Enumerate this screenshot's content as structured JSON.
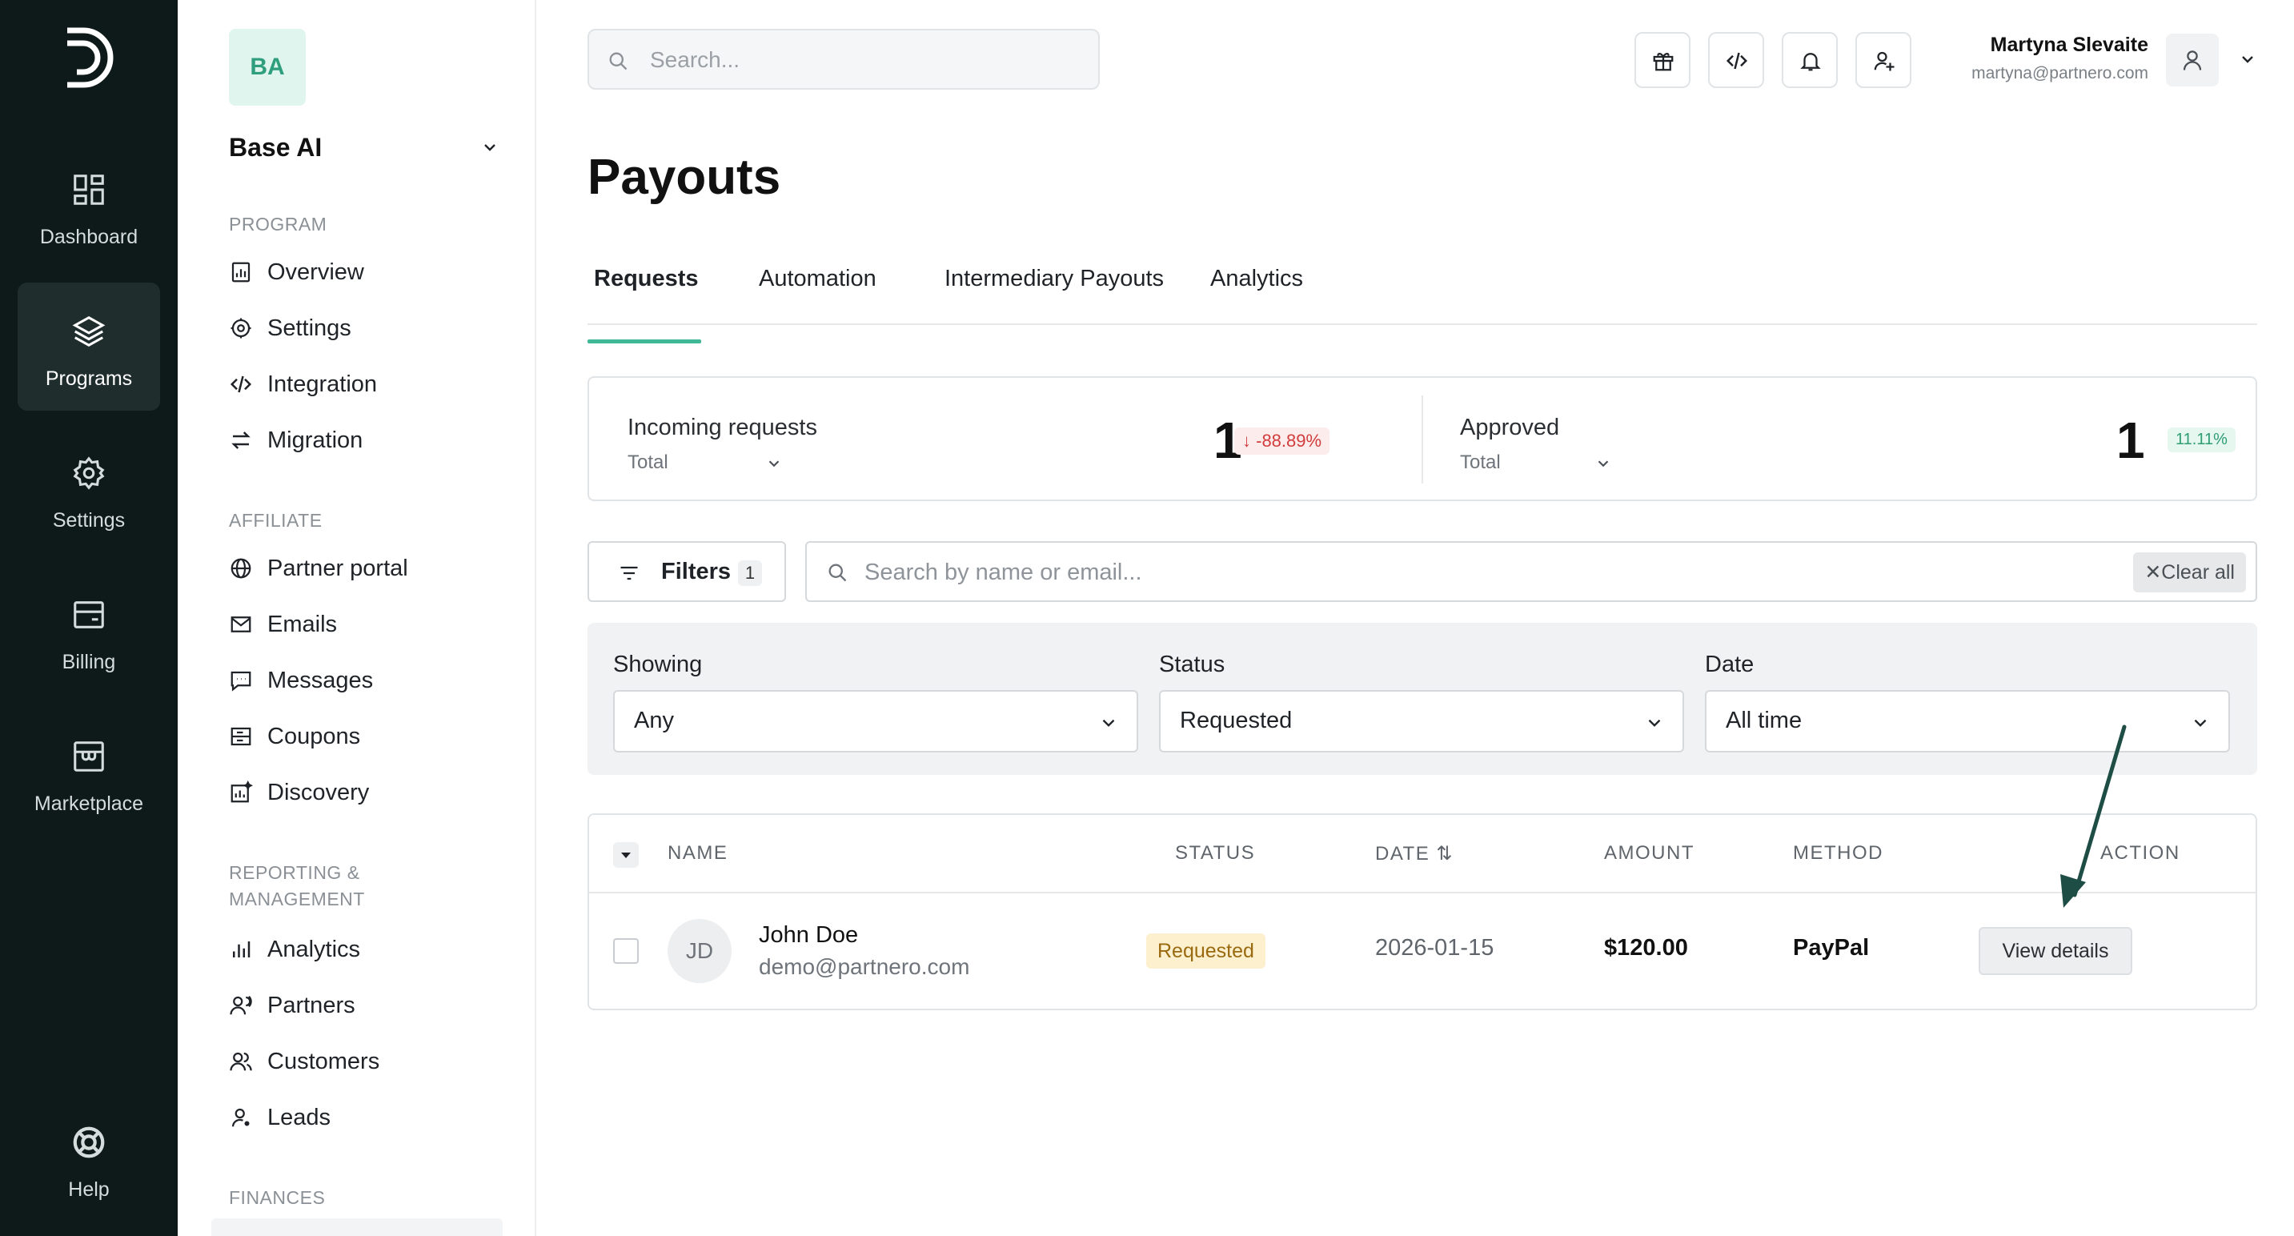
{
  "rail": {
    "items": [
      {
        "label": "Dashboard",
        "icon": "dashboard-icon"
      },
      {
        "label": "Programs",
        "icon": "layers-icon",
        "active": true
      },
      {
        "label": "Settings",
        "icon": "gear-icon"
      },
      {
        "label": "Billing",
        "icon": "wallet-icon"
      },
      {
        "label": "Marketplace",
        "icon": "store-icon"
      }
    ],
    "help": {
      "label": "Help",
      "icon": "lifebuoy-icon"
    }
  },
  "program": {
    "initials": "BA",
    "name": "Base AI"
  },
  "sidebar": {
    "sections": {
      "program": "PROGRAM",
      "affiliate": "AFFILIATE",
      "reporting_line1": "REPORTING &",
      "reporting_line2": "MANAGEMENT",
      "finances": "FINANCES"
    },
    "program_items": [
      {
        "label": "Overview",
        "icon": "chart-file-icon"
      },
      {
        "label": "Settings",
        "icon": "gear-icon"
      },
      {
        "label": "Integration",
        "icon": "code-icon"
      },
      {
        "label": "Migration",
        "icon": "swap-arrows-icon"
      }
    ],
    "affiliate_items": [
      {
        "label": "Partner portal",
        "icon": "globe-icon"
      },
      {
        "label": "Emails",
        "icon": "mail-icon"
      },
      {
        "label": "Messages",
        "icon": "message-icon"
      },
      {
        "label": "Coupons",
        "icon": "coupon-icon"
      },
      {
        "label": "Discovery",
        "icon": "discovery-icon"
      }
    ],
    "reporting_items": [
      {
        "label": "Analytics",
        "icon": "bar-chart-icon"
      },
      {
        "label": "Partners",
        "icon": "partners-icon"
      },
      {
        "label": "Customers",
        "icon": "customers-icon"
      },
      {
        "label": "Leads",
        "icon": "lead-icon"
      }
    ]
  },
  "header": {
    "search_placeholder": "Search...",
    "user_name": "Martyna Slevaite",
    "user_email": "martyna@partnero.com"
  },
  "page": {
    "title": "Payouts",
    "tabs": [
      "Requests",
      "Automation",
      "Intermediary Payouts",
      "Analytics"
    ],
    "active_tab": "Requests"
  },
  "stats": {
    "incoming": {
      "title": "Incoming requests",
      "period": "Total",
      "value": "1",
      "change": "↓ -88.89%"
    },
    "approved": {
      "title": "Approved",
      "period": "Total",
      "value": "1",
      "change": "11.11%"
    }
  },
  "filters": {
    "button_label": "Filters",
    "count": "1",
    "search_placeholder": "Search by name or email...",
    "clear_all": "✕Clear all",
    "showing": {
      "label": "Showing",
      "value": "Any"
    },
    "status": {
      "label": "Status",
      "value": "Requested"
    },
    "date": {
      "label": "Date",
      "value": "All time"
    }
  },
  "table": {
    "columns": [
      "NAME",
      "STATUS",
      "DATE ⇅",
      "AMOUNT",
      "METHOD",
      "ACTION"
    ],
    "rows": [
      {
        "initials": "JD",
        "name": "John Doe",
        "email": "demo@partnero.com",
        "status": "Requested",
        "date": "2026-01-15",
        "amount": "$120.00",
        "method": "PayPal",
        "action": "View details"
      }
    ]
  },
  "colors": {
    "rail_bg": "#0e1a1a",
    "accent": "#3fb896",
    "status_requested_bg": "#fcf0cf",
    "arrow": "#1d4d45"
  }
}
